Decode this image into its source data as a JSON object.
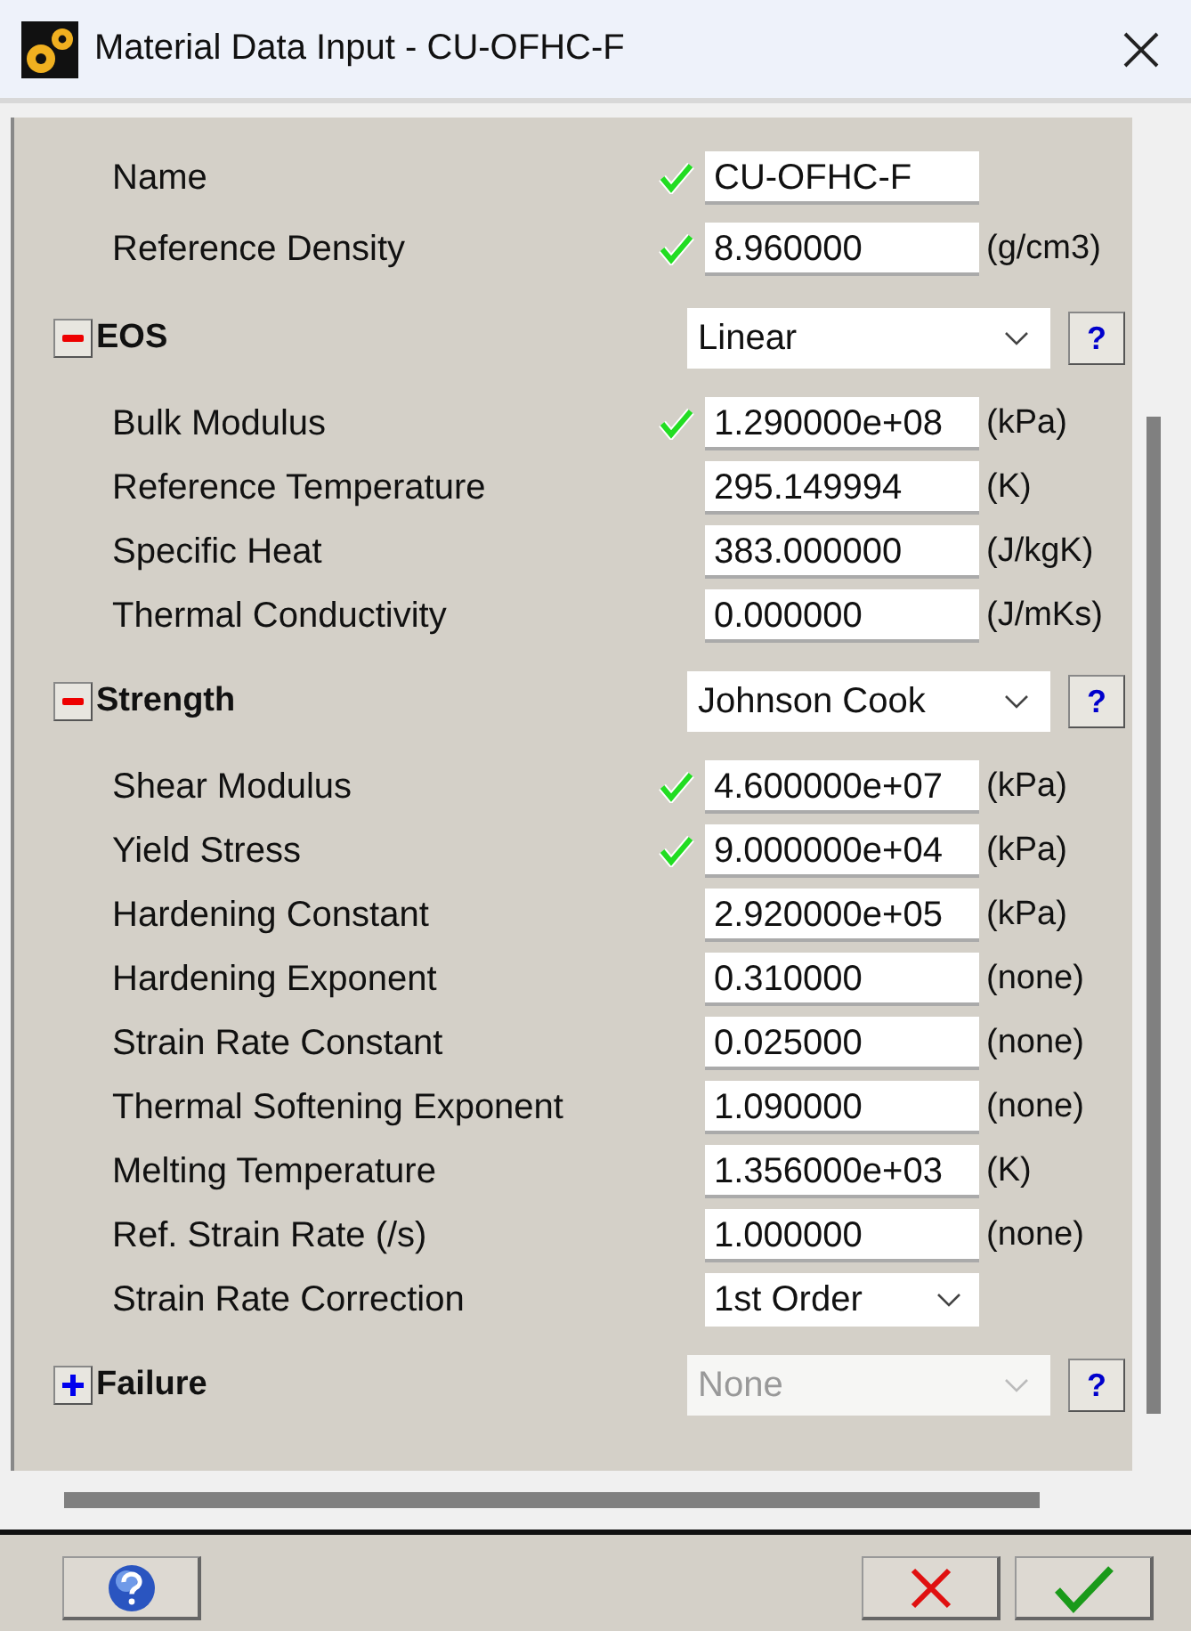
{
  "window": {
    "title": "Material Data Input - CU-OFHC-F"
  },
  "fields": [
    {
      "label": "Name",
      "value": "CU-OFHC-F",
      "valid": true
    },
    {
      "label": "Reference Density",
      "value": "8.960000",
      "unit": "(g/cm3)",
      "valid": true
    }
  ],
  "sections": [
    {
      "title": "EOS",
      "expanded": true,
      "model": "Linear",
      "model_disabled": false,
      "fields": [
        {
          "kind": "text",
          "label": "Bulk Modulus",
          "value": "1.290000e+08",
          "unit": "(kPa)",
          "valid": true
        },
        {
          "kind": "text",
          "label": "Reference Temperature",
          "value": "295.149994",
          "unit": "(K)",
          "valid": false
        },
        {
          "kind": "text",
          "label": "Specific Heat",
          "value": "383.000000",
          "unit": "(J/kgK)",
          "valid": false
        },
        {
          "kind": "text",
          "label": "Thermal Conductivity",
          "value": "0.000000",
          "unit": "(J/mKs)",
          "valid": false
        }
      ]
    },
    {
      "title": "Strength",
      "expanded": true,
      "model": "Johnson Cook",
      "model_disabled": false,
      "fields": [
        {
          "kind": "text",
          "label": "Shear Modulus",
          "value": "4.600000e+07",
          "unit": "(kPa)",
          "valid": true
        },
        {
          "kind": "text",
          "label": "Yield Stress",
          "value": "9.000000e+04",
          "unit": "(kPa)",
          "valid": true
        },
        {
          "kind": "text",
          "label": "Hardening Constant",
          "value": "2.920000e+05",
          "unit": "(kPa)",
          "valid": false
        },
        {
          "kind": "text",
          "label": "Hardening Exponent",
          "value": "0.310000",
          "unit": "(none)",
          "valid": false
        },
        {
          "kind": "text",
          "label": "Strain Rate Constant",
          "value": "0.025000",
          "unit": "(none)",
          "valid": false
        },
        {
          "kind": "text",
          "label": "Thermal Softening Exponent",
          "value": "1.090000",
          "unit": "(none)",
          "valid": false
        },
        {
          "kind": "text",
          "label": "Melting Temperature",
          "value": "1.356000e+03",
          "unit": "(K)",
          "valid": false
        },
        {
          "kind": "text",
          "label": "Ref. Strain Rate (/s)",
          "value": "1.000000",
          "unit": "(none)",
          "valid": false
        },
        {
          "kind": "select",
          "label": "Strain Rate Correction",
          "value": "1st Order",
          "valid": false
        }
      ]
    },
    {
      "title": "Failure",
      "expanded": false,
      "model": "None",
      "model_disabled": true
    }
  ],
  "help_label": "?"
}
